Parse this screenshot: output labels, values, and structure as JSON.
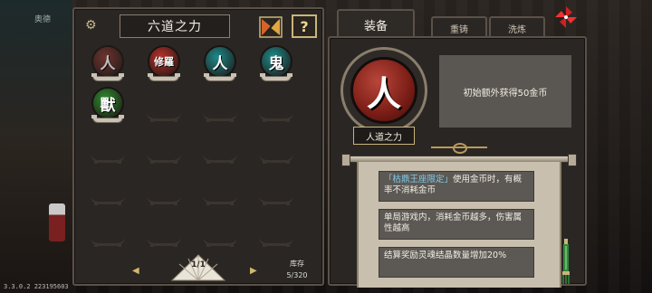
{
  "left_panel": {
    "title": "六道之力",
    "help_label": "?",
    "page_indicator": "1/1",
    "inventory_label": "库存",
    "inventory_count": "5/320",
    "orbs": [
      {
        "glyph": "人",
        "state": "selected-dim",
        "color": "#8a3a36"
      },
      {
        "glyph": "修羅",
        "state": "owned",
        "color": "#b8312a"
      },
      {
        "glyph": "人",
        "state": "owned",
        "color": "#1f8a8a"
      },
      {
        "glyph": "鬼",
        "state": "owned",
        "color": "#1f8a8a"
      },
      {
        "glyph": "獸",
        "state": "owned",
        "color": "#2f8a2f"
      }
    ],
    "empty_slots": 15
  },
  "tabs": [
    {
      "label": "装备",
      "active": true
    },
    {
      "label": "重铸",
      "active": false
    },
    {
      "label": "洗炼",
      "active": false
    }
  ],
  "detail": {
    "orb_glyph": "人",
    "name": "人道之力",
    "description": "初始额外获得50金币",
    "effects": [
      {
        "highlight": "「枯鼎王座限定」",
        "text": "使用金币时，有概率不消耗金币"
      },
      {
        "highlight": "",
        "text": "单局游戏内，消耗金币越多，伤害属性越高"
      },
      {
        "highlight": "",
        "text": "结算奖励灵魂结晶数量增加20%"
      }
    ]
  },
  "background": {
    "tag": "奥德",
    "version": "3.3.0.2 223195603"
  },
  "colors": {
    "accent_gold": "#c9b57a",
    "highlight_blue": "#7fc9e8",
    "panel": "#2a2623"
  }
}
